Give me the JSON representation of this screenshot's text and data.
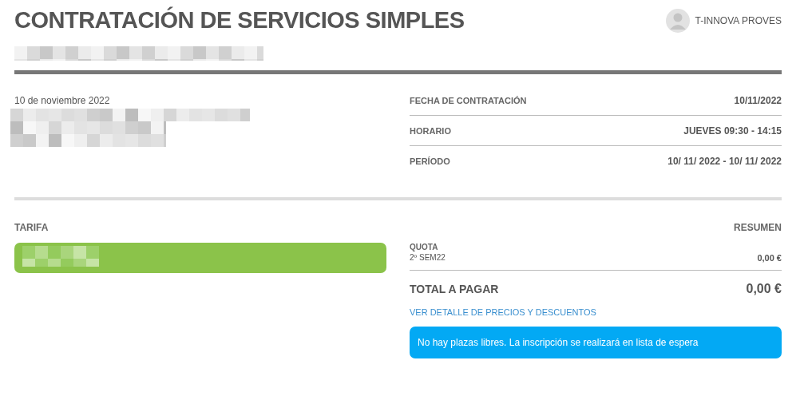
{
  "header": {
    "title": "CONTRATACIÓN DE SERVICIOS SIMPLES",
    "user": "T-INNOVA PROVES"
  },
  "details": {
    "date": "10 de noviembre 2022",
    "rows": [
      {
        "label": "FECHA DE CONTRATACIÓN",
        "value": "10/11/2022"
      },
      {
        "label": "HORARIO",
        "value": "JUEVES 09:30 - 14:15"
      },
      {
        "label": "PERÍODO",
        "value": "10/ 11/ 2022 - 10/ 11/ 2022"
      }
    ]
  },
  "tariff": {
    "heading": "TARIFA"
  },
  "summary": {
    "heading": "RESUMEN",
    "lines": [
      {
        "concept": "QUOTA",
        "period": "2º SEM22",
        "amount": "0,00 €"
      }
    ],
    "total_label": "TOTAL A PAGAR",
    "total": "0,00 €",
    "detail_link": "VER DETALLE DE PRECIOS Y DESCUENTOS",
    "notice": "No hay plazas libres. La inscripción se realizará en lista de espera"
  }
}
